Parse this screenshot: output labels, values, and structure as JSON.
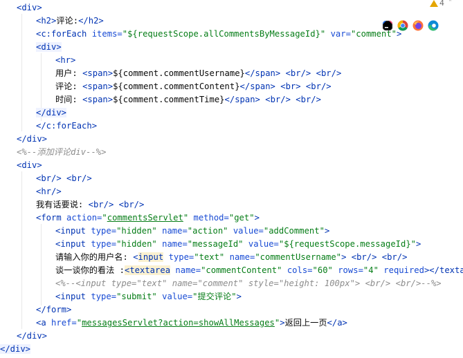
{
  "inspection": {
    "warning_count": "4"
  },
  "browser_icons": [
    {
      "name": "jetbrains-icon",
      "color": "#1a1a1a"
    },
    {
      "name": "chrome-icon",
      "color": "#db4437"
    },
    {
      "name": "firefox-icon",
      "color": "#ff7139"
    },
    {
      "name": "edge-icon",
      "color": "#0c8bd6"
    }
  ],
  "code": {
    "l1": "<div>",
    "l2_tag_open": "<h2>",
    "l2_text": "评论:",
    "l2_tag_close": "</h2>",
    "l3_tag": "<c:forEach",
    "l3_attr1": "items=",
    "l3_val1": "\"${requestScope.allCommentsByMessageId}\"",
    "l3_attr2": "var=",
    "l3_val2": "\"comment\"",
    "l3_end": ">",
    "l4": "<div>",
    "l5": "<hr>",
    "l6_label": "用户: ",
    "l6_span_open": "<span>",
    "l6_expr": "${comment.commentUsername}",
    "l6_span_close": "</span>",
    "l6_tail": " <br/> <br/>",
    "l7_label": "评论: ",
    "l7_span_open": "<span>",
    "l7_expr": "${comment.commentContent}",
    "l7_span_close": "</span>",
    "l7_tail": " <br> <br/>",
    "l8_label": "时间: ",
    "l8_span_open": "<span>",
    "l8_expr": "${comment.commentTime}",
    "l8_span_close": "</span>",
    "l8_tail": " <br/> <br/>",
    "l9": "</div>",
    "l10": "</c:forEach>",
    "l11": "</div>",
    "l12": "<%--添加评论div--%>",
    "l13": "<div>",
    "l14": "<br/> <br/>",
    "l15": "<hr/>",
    "l16_text": "我有话要说: ",
    "l16_tags": "<br/> <br/>",
    "l17_tag": "<form",
    "l17_attr1": "action=",
    "l17_val1": "commentsServlet",
    "l17_q": "\"",
    "l17_attr2": "method=",
    "l17_val2": "\"get\"",
    "l17_end": ">",
    "l18_tag": "<input",
    "l18_attr1": "type=",
    "l18_val1": "\"hidden\"",
    "l18_attr2": "name=",
    "l18_val2": "\"action\"",
    "l18_attr3": "value=",
    "l18_val3": "\"addComment\"",
    "l18_end": ">",
    "l19_tag": "<input",
    "l19_attr1": "type=",
    "l19_val1": "\"hidden\"",
    "l19_attr2": "name=",
    "l19_val2": "\"messageId\"",
    "l19_attr3": "value=",
    "l19_val3": "\"${requestScope.messageId}\"",
    "l19_end": ">",
    "l20_text": "请输入你的用户名: ",
    "l20_lt": "<",
    "l20_tag": "input",
    "l20_attr1": "type=",
    "l20_val1": "\"text\"",
    "l20_attr2": "name=",
    "l20_val2": "\"commentUsername\"",
    "l20_tail": "> <br/> <br/>",
    "l21_text": "谈一谈你的看法 :",
    "l21_tag": "<textarea",
    "l21_attr1": "name=",
    "l21_val1": "\"commentContent\"",
    "l21_attr2": "cols=",
    "l21_val2": "\"60\"",
    "l21_attr3": "rows=",
    "l21_val3": "\"4\"",
    "l21_attr4": "required",
    "l21_end": "></textarea>",
    "l22": "<%--<input type=\"text\" name=\"comment\" style=\"height: 100px\"> <br/> <br/>--%>",
    "l23_tag": "<input",
    "l23_attr1": "type=",
    "l23_val1": "\"submit\"",
    "l23_attr2": "value=",
    "l23_val2": "\"提交评论\"",
    "l23_end": ">",
    "l24": "</form>",
    "l25_tag": "<a",
    "l25_attr1": "href=",
    "l25_q1": "\"",
    "l25_href": "messagesServlet?action=showAllMessages",
    "l25_q2": "\"",
    "l25_gt": ">",
    "l25_text": "返回上一页",
    "l25_close": "</a>",
    "l26": "</div>",
    "l27": "</div>"
  }
}
